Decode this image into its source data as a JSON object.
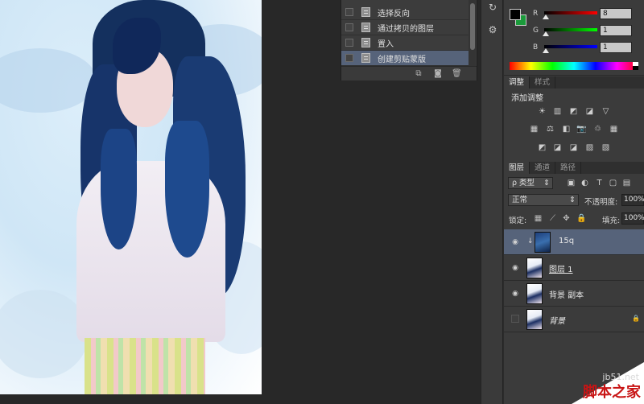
{
  "history": {
    "items": [
      {
        "label": "选择反向",
        "selected": false
      },
      {
        "label": "通过拷贝的图层",
        "selected": false
      },
      {
        "label": "置入",
        "selected": false
      },
      {
        "label": "创建剪贴蒙版",
        "selected": true
      }
    ]
  },
  "color_panel": {
    "foreground": "#000000",
    "background": "#1a9a3a",
    "channels": [
      {
        "label": "R",
        "value": "8",
        "color": "#c81e1e"
      },
      {
        "label": "G",
        "value": "1",
        "color": "#2aa53a"
      },
      {
        "label": "B",
        "value": "1",
        "color": "#1e3fc8"
      }
    ]
  },
  "adjust_tabs": [
    "调整",
    "样式"
  ],
  "adjustments_title": "添加调整",
  "adjust_icons": [
    [
      "☀",
      "▥",
      "◩",
      "◪",
      "▽"
    ],
    [
      "▦",
      "⚖",
      "◧",
      "📷",
      "♲",
      "▦"
    ],
    [
      "◩",
      "◪",
      "◪",
      "▨",
      "▧"
    ]
  ],
  "layer_tabs": [
    "图层",
    "通道",
    "路径"
  ],
  "layers": {
    "kind_label": "ρ 类型",
    "blend_mode": "正常",
    "opacity_label": "不透明度:",
    "opacity_value": "100%",
    "lock_label": "锁定:",
    "fill_label": "填充:",
    "fill_value": "100%",
    "rows": [
      {
        "name": "15q",
        "selected": true,
        "visible": true
      },
      {
        "name": "图层 1",
        "selected": false,
        "visible": true
      },
      {
        "name": "背景 副本",
        "selected": false,
        "visible": true
      },
      {
        "name": "背景",
        "selected": false,
        "visible": false
      }
    ]
  },
  "watermark": {
    "site": "jb51.net",
    "cn": "脚本之家"
  }
}
